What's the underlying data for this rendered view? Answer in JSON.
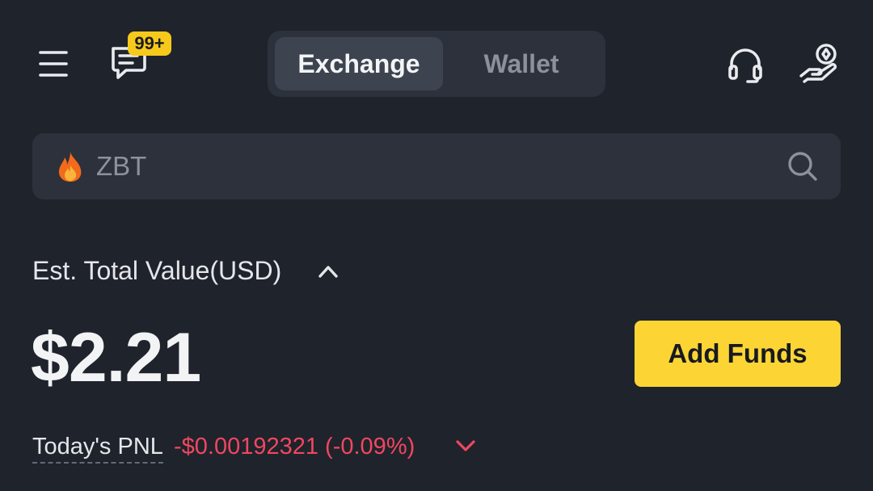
{
  "header": {
    "menu_icon": "hamburger-menu-icon",
    "messages_icon": "chat-bubble-icon",
    "messages_badge": "99+",
    "tabs": [
      {
        "label": "Exchange",
        "active": true
      },
      {
        "label": "Wallet",
        "active": false
      }
    ],
    "support_icon": "headset-icon",
    "promo_icon": "hand-coin-icon"
  },
  "search": {
    "prefix_icon": "fire-icon",
    "placeholder": "ZBT",
    "icon": "search-icon"
  },
  "balance": {
    "label": "Est. Total Value(USD)",
    "toggle_icon": "chevron-up-icon",
    "amount": "$2.21",
    "add_funds_label": "Add Funds"
  },
  "pnl": {
    "label": "Today's PNL",
    "value": "-$0.00192321 (-0.09%)",
    "toggle_icon": "chevron-down-icon"
  },
  "colors": {
    "background": "#1f232c",
    "surface": "#2c313b",
    "accent_yellow": "#fcd535",
    "badge_yellow": "#f6c91b",
    "negative_red": "#f0475f"
  }
}
